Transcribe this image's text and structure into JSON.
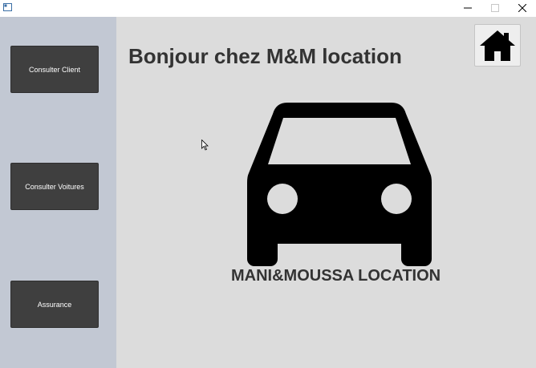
{
  "window": {
    "icons": {
      "app": "app-window-icon",
      "minimize": "minimize-icon",
      "maximize": "maximize-icon",
      "close": "close-icon"
    }
  },
  "sidebar": {
    "background": "#c2c8d3",
    "buttons": [
      {
        "label": "Consulter Client"
      },
      {
        "label": "Consulter Voitures"
      },
      {
        "label": "Assurance"
      }
    ]
  },
  "main": {
    "background": "#dcdcdc",
    "title": "Bonjour chez M&M location",
    "home_icon": "home-icon",
    "logo_icon": "car-icon",
    "brand": "MANI&MOUSSA LOCATION"
  },
  "colors": {
    "button_bg": "#3f3f3f",
    "title_text": "#333333"
  }
}
